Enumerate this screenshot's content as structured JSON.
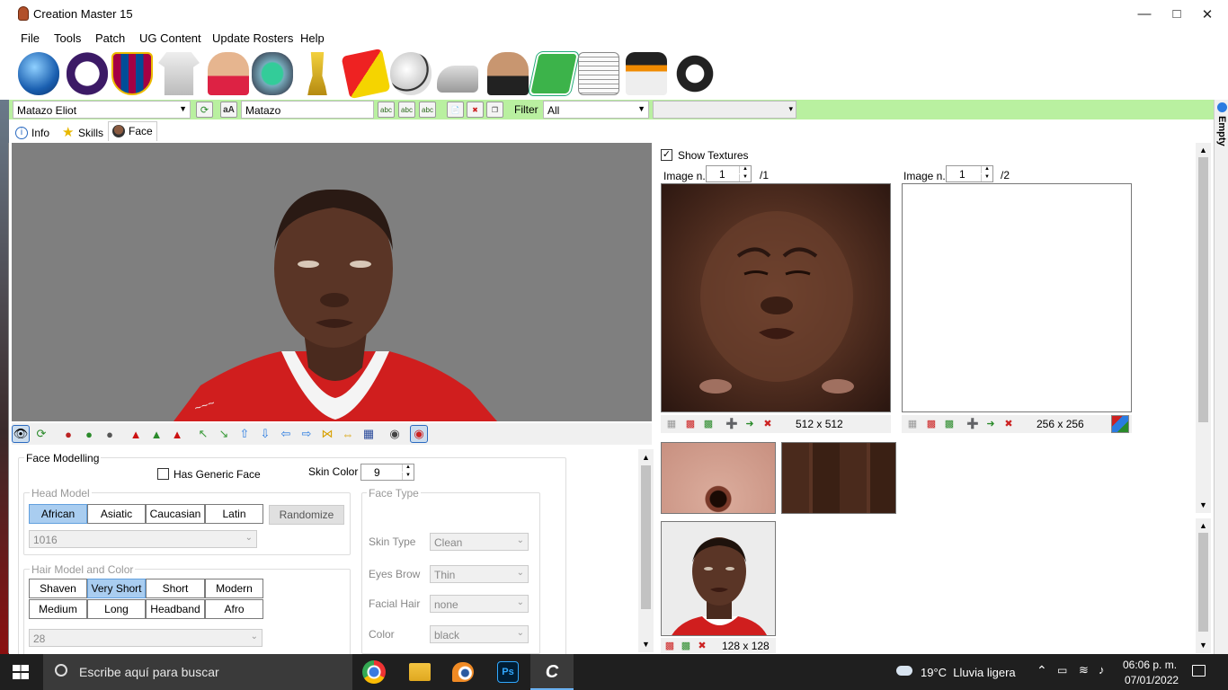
{
  "window": {
    "title": "Creation Master 15"
  },
  "menu": [
    "File",
    "Tools",
    "Patch",
    "UG Content",
    "Update Rosters",
    "Help"
  ],
  "toolbar_icons": [
    "globe-icon",
    "premier-league-icon",
    "fcb-crest-icon",
    "kit-icon",
    "player-icon",
    "stadium-icon",
    "trophy-icon",
    "referee-cards-icon",
    "ball-icon",
    "boots-icon",
    "manager-icon",
    "pitch-icon",
    "newspaper-icon",
    "gloves-icon",
    "headphones-icon"
  ],
  "selector": {
    "player": "Matazo Eliot",
    "short_name": "Matazo",
    "filter_label": "Filter",
    "filter_value": "All",
    "extra_value": ""
  },
  "side_tab": "Empty",
  "tabs": [
    {
      "label": "Info"
    },
    {
      "label": "Skills"
    },
    {
      "label": "Face"
    }
  ],
  "face": {
    "title": "Face Modelling",
    "has_generic_face": "Has Generic Face",
    "skin_color_label": "Skin Color",
    "skin_color_value": "9",
    "head_model": {
      "label": "Head Model",
      "options": [
        "African",
        "Asiatic",
        "Caucasian",
        "Latin"
      ],
      "selected": "African",
      "randomize": "Randomize",
      "model_id": "1016"
    },
    "hair": {
      "label": "Hair Model and Color",
      "options": [
        "Shaven",
        "Very Short",
        "Short",
        "Modern",
        "Medium",
        "Long",
        "Headband",
        "Afro"
      ],
      "selected": "Very Short",
      "model_id": "28"
    },
    "face_type": {
      "label": "Face Type",
      "skin_type_label": "Skin Type",
      "skin_type": "Clean",
      "eyes_brow_label": "Eyes Brow",
      "eyes_brow": "Thin",
      "facial_hair_label": "Facial Hair",
      "facial_hair": "none",
      "color_label": "Color",
      "color": "black"
    }
  },
  "textures": {
    "show_textures": "Show Textures",
    "left": {
      "label": "Image n.",
      "value": "1",
      "total": "/1",
      "size": "512 x 512"
    },
    "right": {
      "label": "Image n.",
      "value": "1",
      "total": "/2",
      "size": "256 x 256"
    },
    "photo_size": "128 x 128"
  },
  "taskbar": {
    "search_placeholder": "Escribe aquí para buscar",
    "weather": "19°C  Lluvia ligera",
    "time": "06:06 p. m.",
    "date": "07/01/2022"
  },
  "colors": {
    "accent_green": "#b9f0a0",
    "selected_blue": "#a9cdf0",
    "viewport_gray": "#7f7f7f",
    "skin": "#5a3526",
    "jersey_red": "#d01e1e"
  }
}
